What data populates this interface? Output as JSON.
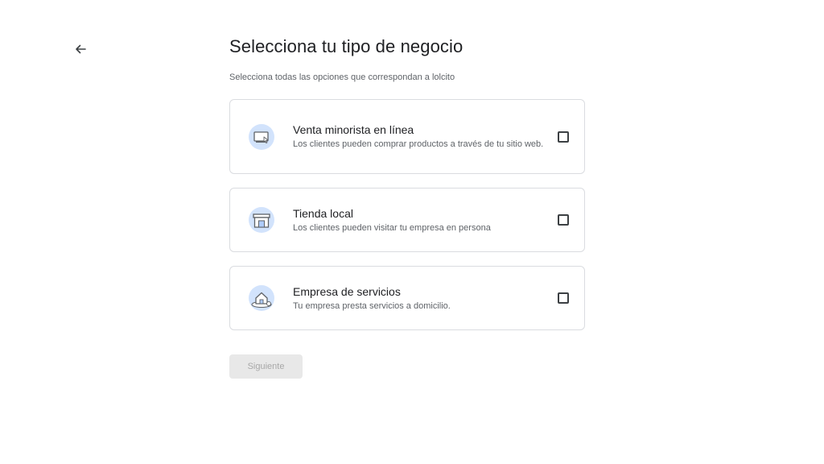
{
  "header": {
    "back_icon": "arrow-back-icon",
    "title": "Selecciona tu tipo de negocio",
    "subtitle": "Selecciona todas las opciones que correspondan a lolcito"
  },
  "options": [
    {
      "icon": "online-retail-icon",
      "title": "Venta minorista en línea",
      "description": "Los clientes pueden comprar productos a través de tu sitio web.",
      "checked": false
    },
    {
      "icon": "local-store-icon",
      "title": "Tienda local",
      "description": "Los clientes pueden visitar tu empresa en persona",
      "checked": false
    },
    {
      "icon": "service-business-icon",
      "title": "Empresa de servicios",
      "description": "Tu empresa presta servicios a domicilio.",
      "checked": false
    }
  ],
  "footer": {
    "next_label": "Siguiente",
    "next_enabled": false
  },
  "colors": {
    "icon_bg": "#d2e3fc",
    "icon_stroke": "#5f6368",
    "border": "#dadce0",
    "disabled_button_bg": "#e8e8e8",
    "disabled_button_text": "#a8a8a8"
  }
}
